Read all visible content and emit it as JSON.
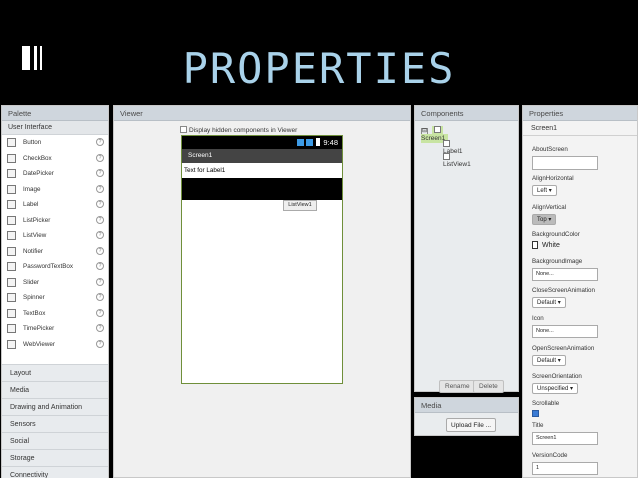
{
  "slide": {
    "title": "PROPERTIES"
  },
  "palette": {
    "header": "Palette",
    "open_category": "User Interface",
    "items": [
      {
        "label": "Button",
        "icon": "button-icon"
      },
      {
        "label": "CheckBox",
        "icon": "checkbox-icon"
      },
      {
        "label": "DatePicker",
        "icon": "datepicker-icon"
      },
      {
        "label": "Image",
        "icon": "image-icon"
      },
      {
        "label": "Label",
        "icon": "label-icon"
      },
      {
        "label": "ListPicker",
        "icon": "listpicker-icon"
      },
      {
        "label": "ListView",
        "icon": "listview-icon"
      },
      {
        "label": "Notifier",
        "icon": "notifier-icon"
      },
      {
        "label": "PasswordTextBox",
        "icon": "password-icon"
      },
      {
        "label": "Slider",
        "icon": "slider-icon"
      },
      {
        "label": "Spinner",
        "icon": "spinner-icon"
      },
      {
        "label": "TextBox",
        "icon": "textbox-icon"
      },
      {
        "label": "TimePicker",
        "icon": "timepicker-icon"
      },
      {
        "label": "WebViewer",
        "icon": "webviewer-icon"
      }
    ],
    "help_glyph": "?",
    "categories": [
      "Layout",
      "Media",
      "Drawing and Animation",
      "Sensors",
      "Social",
      "Storage",
      "Connectivity"
    ]
  },
  "viewer": {
    "header": "Viewer",
    "checkbox_label": "Display hidden components in Viewer",
    "time": "9:48",
    "screen_title": "Screen1",
    "label_text": "Text for Label1",
    "listview_button": "ListView1"
  },
  "components": {
    "header": "Components",
    "collapse_glyph": "⊟",
    "tree": {
      "screen": "Screen1",
      "label": "Label1",
      "list": "ListView1"
    },
    "rename": "Rename",
    "delete": "Delete"
  },
  "media": {
    "header": "Media",
    "upload": "Upload File ..."
  },
  "properties": {
    "header": "Properties",
    "screen": "Screen1",
    "about_label": "AboutScreen",
    "align_h_label": "AlignHorizontal",
    "align_h_value": "Left",
    "align_v_label": "AlignVertical",
    "align_v_value": "Top",
    "bg_color_label": "BackgroundColor",
    "bg_color_value": "White",
    "bg_image_label": "BackgroundImage",
    "bg_image_value": "None...",
    "close_anim_label": "CloseScreenAnimation",
    "close_anim_value": "Default",
    "icon_label": "Icon",
    "icon_value": "None...",
    "open_anim_label": "OpenScreenAnimation",
    "open_anim_value": "Default",
    "orientation_label": "ScreenOrientation",
    "orientation_value": "Unspecified",
    "scrollable_label": "Scrollable",
    "title_label": "Title",
    "title_value": "Screen1",
    "version_label": "VersionCode",
    "version_value": "1",
    "caret": "▾"
  },
  "colors": {
    "title": "#a9d2ea",
    "selected": "#c8e4a2",
    "panel_head": "#cfd6dd",
    "phone_border": "#6f8f3a"
  }
}
